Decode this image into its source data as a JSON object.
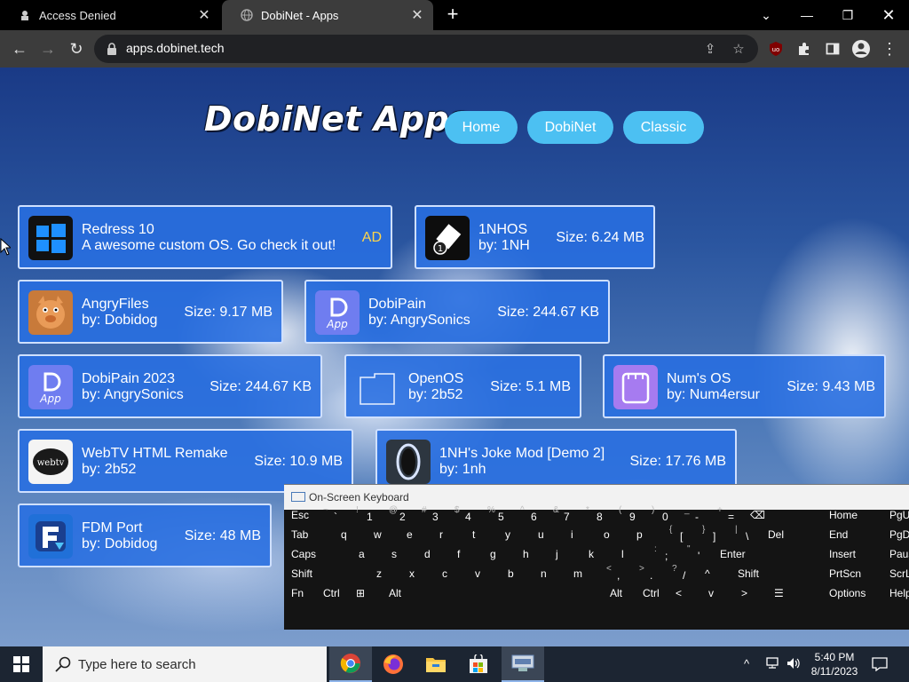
{
  "browser": {
    "tabs": [
      {
        "title": "Access Denied",
        "active": false
      },
      {
        "title": "DobiNet - Apps",
        "active": true
      }
    ],
    "url": "apps.dobinet.tech"
  },
  "page": {
    "logo": "DobiNet Apps",
    "nav": [
      "Home",
      "DobiNet",
      "Classic"
    ],
    "apps": [
      {
        "name": "Redress 10",
        "subtitle": "A awesome custom OS. Go check it out!",
        "size": "",
        "badge": "AD",
        "icon": "windows-logo-icon"
      },
      {
        "name": "1NHOS",
        "subtitle": "by: 1NH",
        "size": "Size: 6.24 MB",
        "badge": "",
        "icon": "eraser-1-icon"
      },
      {
        "name": "AngryFiles",
        "subtitle": "by: Dobidog",
        "size": "Size: 9.17 MB",
        "badge": "",
        "icon": "angry-pig-icon"
      },
      {
        "name": "DobiPain",
        "subtitle": "by: AngrySonics",
        "size": "Size: 244.67 KB",
        "badge": "",
        "icon": "dobi-app-icon"
      },
      {
        "name": "DobiPain 2023",
        "subtitle": "by: AngrySonics",
        "size": "Size: 244.67 KB",
        "badge": "",
        "icon": "dobi-app-icon"
      },
      {
        "name": "OpenOS",
        "subtitle": "by: 2b52",
        "size": "Size: 5.1 MB",
        "badge": "",
        "icon": "folder-outline-icon"
      },
      {
        "name": "Num's OS",
        "subtitle": "by: Num4ersur",
        "size": "Size: 9.43 MB",
        "badge": "",
        "icon": "purple-window-icon"
      },
      {
        "name": "WebTV HTML Remake",
        "subtitle": "by: 2b52",
        "size": "Size: 10.9 MB",
        "badge": "",
        "icon": "webtv-logo-icon"
      },
      {
        "name": "1NH's Joke Mod [Demo 2]",
        "subtitle": "by: 1nh",
        "size": "Size: 17.76 MB",
        "badge": "",
        "icon": "portal-ring-icon"
      },
      {
        "name": "FDM Port",
        "subtitle": "by: Dobidog",
        "size": "Size: 48 MB",
        "badge": "",
        "icon": "fdm-logo-icon"
      }
    ]
  },
  "osk": {
    "title": "On-Screen Keyboard",
    "rows": [
      [
        {
          "label": "Esc"
        },
        {
          "sup": "~",
          "low": "`"
        },
        {
          "sup": "!",
          "low": "1"
        },
        {
          "sup": "@",
          "low": "2"
        },
        {
          "sup": "#",
          "low": "3"
        },
        {
          "sup": "$",
          "low": "4"
        },
        {
          "sup": "%",
          "low": "5"
        },
        {
          "sup": "^",
          "low": "6"
        },
        {
          "sup": "&",
          "low": "7"
        },
        {
          "sup": "*",
          "low": "8"
        },
        {
          "sup": "(",
          "low": "9"
        },
        {
          "sup": ")",
          "low": "0"
        },
        {
          "sup": "_",
          "low": "-"
        },
        {
          "sup": "+",
          "low": "="
        },
        {
          "label": "⌫"
        }
      ],
      [
        {
          "label": "Tab"
        },
        {
          "label": "q"
        },
        {
          "label": "w"
        },
        {
          "label": "e"
        },
        {
          "label": "r"
        },
        {
          "label": "t"
        },
        {
          "label": "y"
        },
        {
          "label": "u"
        },
        {
          "label": "i"
        },
        {
          "label": "o"
        },
        {
          "label": "p"
        },
        {
          "sup": "{",
          "low": "["
        },
        {
          "sup": "}",
          "low": "]"
        },
        {
          "sup": "|",
          "low": "\\"
        },
        {
          "label": "Del"
        }
      ],
      [
        {
          "label": "Caps"
        },
        {
          "label": "a"
        },
        {
          "label": "s"
        },
        {
          "label": "d"
        },
        {
          "label": "f"
        },
        {
          "label": "g"
        },
        {
          "label": "h"
        },
        {
          "label": "j"
        },
        {
          "label": "k"
        },
        {
          "label": "l"
        },
        {
          "sup": ":",
          "low": ";"
        },
        {
          "sup": "\"",
          "low": "'"
        },
        {
          "label": "Enter"
        }
      ],
      [
        {
          "label": "Shift"
        },
        {
          "label": "z"
        },
        {
          "label": "x"
        },
        {
          "label": "c"
        },
        {
          "label": "v"
        },
        {
          "label": "b"
        },
        {
          "label": "n"
        },
        {
          "label": "m"
        },
        {
          "sup": "<",
          "low": ","
        },
        {
          "sup": ">",
          "low": "."
        },
        {
          "sup": "?",
          "low": "/"
        },
        {
          "label": "^"
        },
        {
          "label": "Shift"
        }
      ],
      [
        {
          "label": "Fn"
        },
        {
          "label": "Ctrl"
        },
        {
          "label": "⊞"
        },
        {
          "label": "Alt"
        },
        {
          "label": ""
        },
        {
          "label": "Alt"
        },
        {
          "label": "Ctrl"
        },
        {
          "label": "<"
        },
        {
          "label": "v"
        },
        {
          "label": ">"
        },
        {
          "label": "☰"
        }
      ]
    ],
    "nav_keys": [
      [
        "Home",
        "PgUp"
      ],
      [
        "End",
        "PgDn"
      ],
      [
        "Insert",
        "Pause"
      ],
      [
        "PrtScn",
        "ScrLk"
      ],
      [
        "Options",
        "Help"
      ]
    ]
  },
  "taskbar": {
    "search_placeholder": "Type here to search",
    "time": "5:40 PM",
    "date": "8/11/2023"
  }
}
